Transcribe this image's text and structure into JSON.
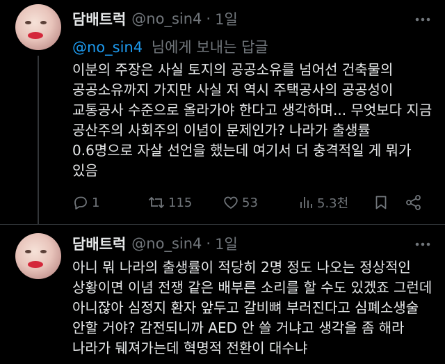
{
  "tweet1": {
    "display_name": "담배트럭",
    "handle": "@no_sin4",
    "separator": "·",
    "time": "1일",
    "reply_mention": "@no_sin4",
    "reply_suffix": "님에게 보내는 답글",
    "lines": [
      "이분의 주장은 사실 토지의 공공소유를 넘어선 건축물의",
      "공공소유까지 가지만 사실 저 역시 주택공사의 공공성이",
      "교통공사 수준으로 올라가야 한다고 생각하며... 무엇보다 지금",
      "공산주의 사회주의 이념이 문제인가? 나라가 출생률",
      "0.6명으로 자살 선언을 했는데 여기서 더 충격적일 게 뭐가",
      "있음"
    ],
    "actions": {
      "reply_count": "1",
      "retweet_count": "115",
      "like_count": "53",
      "view_count": "5.3천"
    },
    "icons": [
      "reply-icon",
      "retweet-icon",
      "like-icon",
      "views-icon",
      "bookmark-icon",
      "share-icon",
      "more-icon"
    ]
  },
  "tweet2": {
    "display_name": "담배트럭",
    "handle": "@no_sin4",
    "separator": "·",
    "time": "1일",
    "lines": [
      "아니 뭐 나라의 출생률이 적당히 2명 정도 나오는 정상적인",
      "상황이면 이념 전쟁 같은 배부른 소리를 할 수도 있겠죠 그런데",
      "아니잖아 심정지 환자 앞두고 갈비뼈 부러진다고 심폐소생술",
      "안할 거야? 감전되니까 AED 안 쓸 거냐고 생각을 좀 해라",
      "나라가 뒈져가는데 혁명적 전환이 대수냐"
    ]
  },
  "colors": {
    "background": "#000000",
    "text": "#e7e9ea",
    "muted": "#71767b",
    "link": "#1d9bf0",
    "divider": "#2f3336"
  }
}
